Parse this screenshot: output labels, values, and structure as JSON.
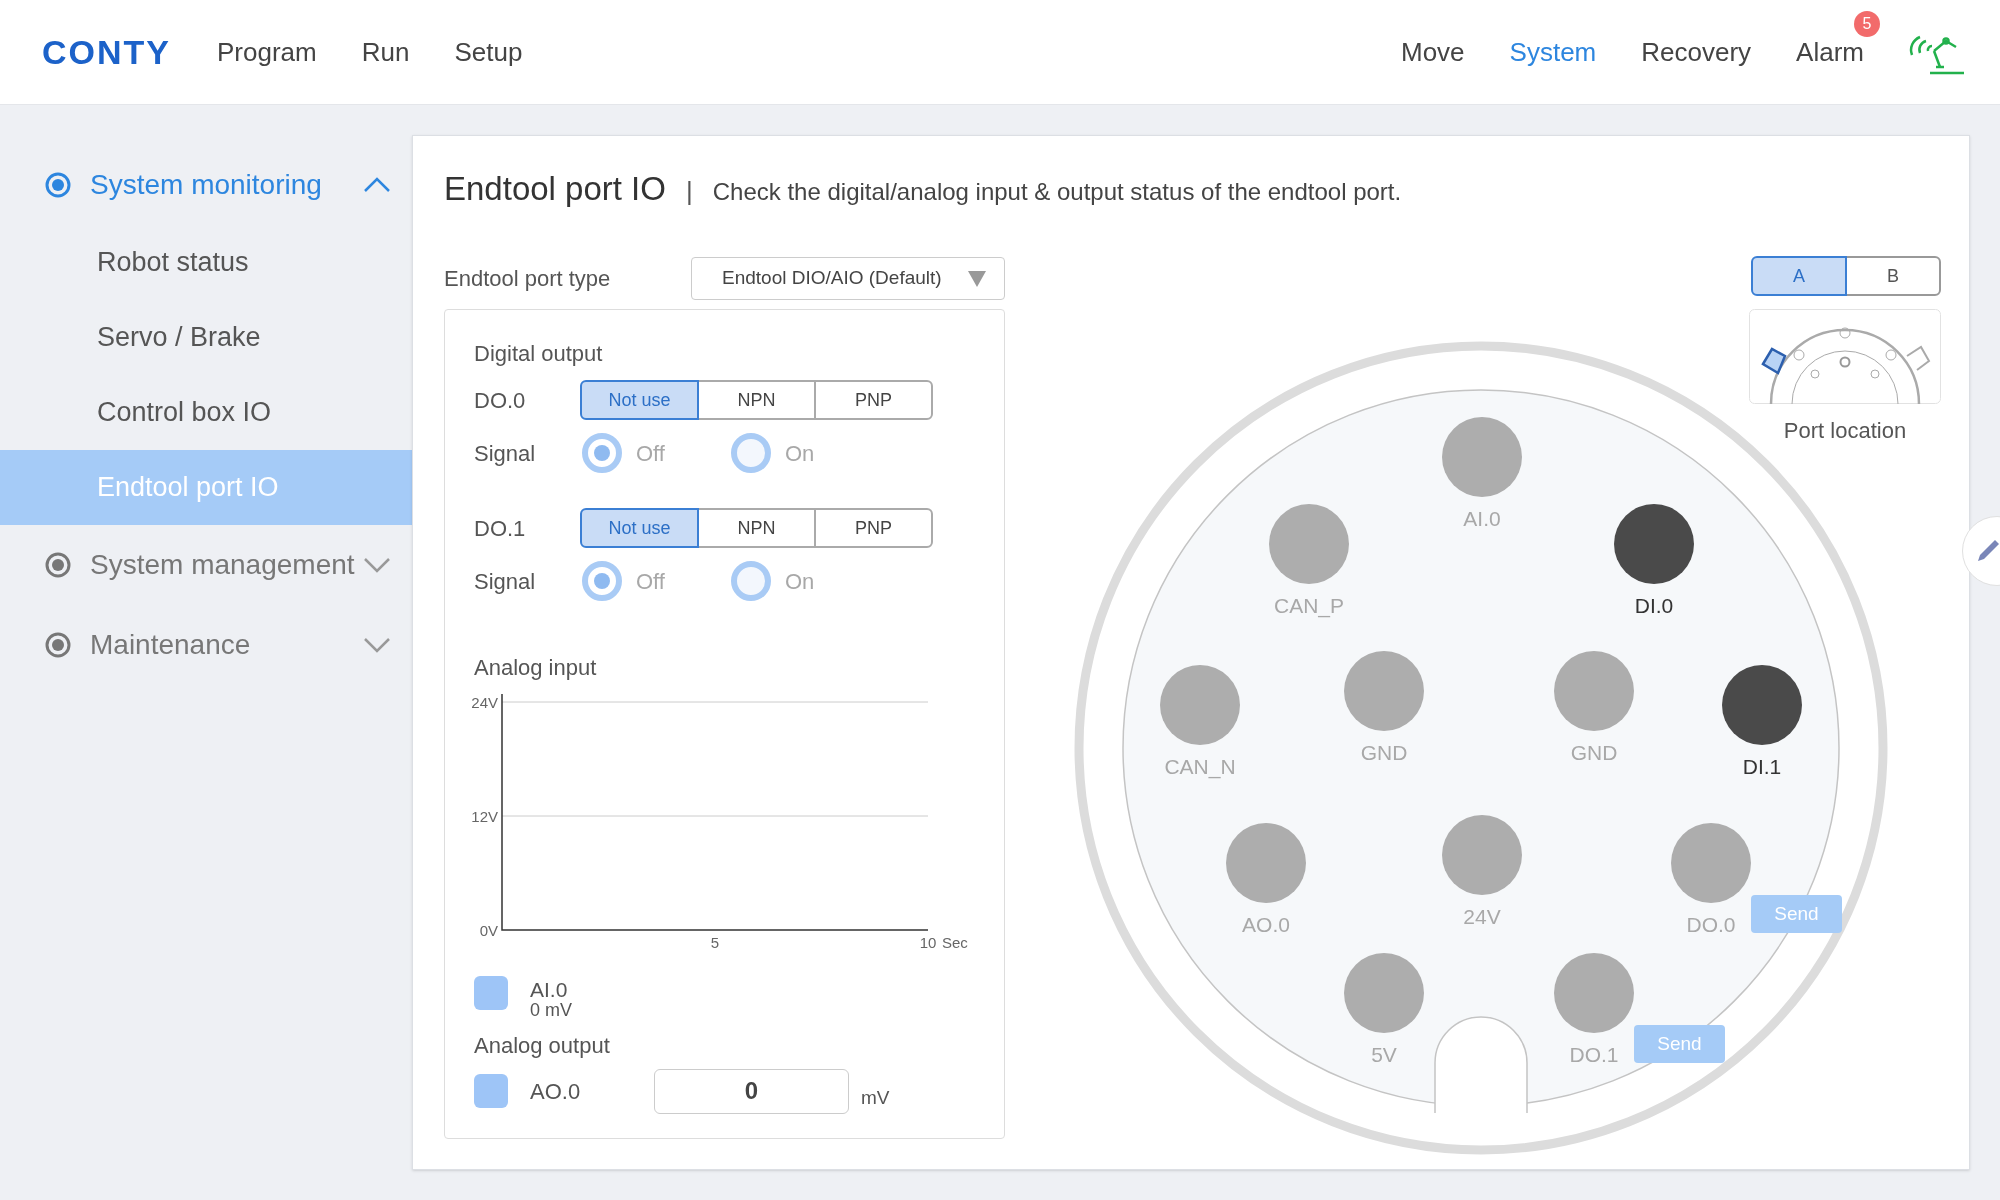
{
  "header": {
    "logo": "CONTY",
    "nav_left": [
      {
        "label": "Program",
        "selected": false
      },
      {
        "label": "Run",
        "selected": false
      },
      {
        "label": "Setup",
        "selected": false
      }
    ],
    "nav_right": [
      {
        "label": "Move",
        "selected": false
      },
      {
        "label": "System",
        "selected": true
      },
      {
        "label": "Recovery",
        "selected": false
      },
      {
        "label": "Alarm",
        "selected": false,
        "badge": "5"
      }
    ]
  },
  "sidebar": {
    "sections": [
      {
        "label": "System monitoring",
        "selected": true,
        "expanded": true,
        "items": [
          {
            "label": "Robot status",
            "selected": false
          },
          {
            "label": "Servo / Brake",
            "selected": false
          },
          {
            "label": "Control box IO",
            "selected": false
          },
          {
            "label": "Endtool port IO",
            "selected": true
          }
        ]
      },
      {
        "label": "System management",
        "selected": false,
        "expanded": false
      },
      {
        "label": "Maintenance",
        "selected": false,
        "expanded": false
      }
    ]
  },
  "page": {
    "title": "Endtool port IO",
    "separator": "|",
    "description": "Check the digital/analog input & output status of the endtool port.",
    "port_type": {
      "label": "Endtool port type",
      "value": "Endtool DIO/AIO (Default)"
    },
    "digital_output": {
      "title": "Digital output",
      "outputs": [
        {
          "name": "DO.0",
          "modes": [
            {
              "label": "Not use",
              "selected": true
            },
            {
              "label": "NPN",
              "selected": false
            },
            {
              "label": "PNP",
              "selected": false
            }
          ],
          "signal_label": "Signal",
          "disabled": true,
          "signals": [
            {
              "label": "Off",
              "selected": true
            },
            {
              "label": "On",
              "selected": false
            }
          ]
        },
        {
          "name": "DO.1",
          "modes": [
            {
              "label": "Not use",
              "selected": true
            },
            {
              "label": "NPN",
              "selected": false
            },
            {
              "label": "PNP",
              "selected": false
            }
          ],
          "signal_label": "Signal",
          "disabled": true,
          "signals": [
            {
              "label": "Off",
              "selected": true
            },
            {
              "label": "On",
              "selected": false
            }
          ]
        }
      ]
    },
    "analog_input": {
      "title": "Analog input",
      "chart_data": {
        "type": "line",
        "xlabel": "Sec",
        "xlim": [
          0,
          10
        ],
        "ylim": [
          0,
          24
        ],
        "xticks": [
          5,
          10
        ],
        "yticks": [
          {
            "value": 0,
            "label": "0V"
          },
          {
            "value": 12,
            "label": "12V"
          },
          {
            "value": 24,
            "label": "24V"
          }
        ]
      },
      "legend": [
        {
          "name": "AI.0",
          "reading": "0 mV",
          "color": "#9ec5f7"
        }
      ]
    },
    "analog_output": {
      "title": "Analog output",
      "outputs": [
        {
          "name": "AO.0",
          "color": "#9ec5f7",
          "value": "0",
          "unit": "mV"
        }
      ]
    },
    "port_tabs": [
      {
        "label": "A",
        "selected": true
      },
      {
        "label": "B",
        "selected": false
      }
    ],
    "port_location_label": "Port location",
    "pins": [
      {
        "label": "AI.0",
        "on": false
      },
      {
        "label": "CAN_P",
        "on": false
      },
      {
        "label": "DI.0",
        "on": true
      },
      {
        "label": "CAN_N",
        "on": false
      },
      {
        "label": "GND",
        "on": false
      },
      {
        "label": "GND",
        "on": false
      },
      {
        "label": "DI.1",
        "on": true
      },
      {
        "label": "AO.0",
        "on": false
      },
      {
        "label": "24V",
        "on": false
      },
      {
        "label": "DO.0",
        "on": false,
        "action": "Send"
      },
      {
        "label": "5V",
        "on": false
      },
      {
        "label": "DO.1",
        "on": false,
        "action": "Send"
      }
    ]
  }
}
